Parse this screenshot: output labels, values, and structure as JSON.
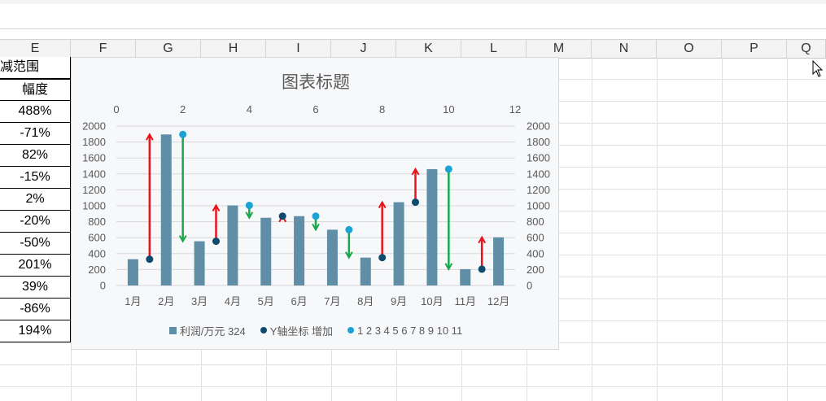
{
  "columns": [
    "E",
    "F",
    "G",
    "H",
    "I",
    "J",
    "K",
    "L",
    "M",
    "N",
    "O",
    "P",
    "Q"
  ],
  "table": {
    "header_partial": "减范围",
    "col_header": "幅度",
    "values": [
      "488%",
      "-71%",
      "82%",
      "-15%",
      "2%",
      "-20%",
      "-50%",
      "201%",
      "39%",
      "-86%",
      "194%"
    ]
  },
  "chart": {
    "title": "图表标题",
    "legend": {
      "bars": "利润/万元 324",
      "dark_points": "Y轴坐标 增加",
      "light_points": "1 2 3 4 5 6 7 8 9 10 11"
    },
    "colors": {
      "bar": "#5f8ea6",
      "dark_point": "#0e4a6e",
      "light_point": "#1aa3d4",
      "up_arrow": "#e8141c",
      "down_arrow": "#18a84a",
      "gridline": "#d9d9d9"
    }
  },
  "chart_data": {
    "type": "bar",
    "title": "图表标题",
    "categories": [
      "1月",
      "2月",
      "3月",
      "4月",
      "5月",
      "6月",
      "7月",
      "8月",
      "9月",
      "10月",
      "11月",
      "12月"
    ],
    "series": [
      {
        "name": "利润/万元 324",
        "type": "bar",
        "values": [
          330,
          1895,
          555,
          1005,
          850,
          870,
          700,
          350,
          1045,
          1460,
          205,
          605
        ]
      },
      {
        "name": "Y轴坐标 增加",
        "type": "scatter",
        "x": [
          1,
          3,
          5,
          9,
          11,
          8
        ],
        "y": [
          330,
          555,
          870,
          1045,
          205,
          350
        ]
      },
      {
        "name": "1 2 3 4 5 6 7 8 9 10 11",
        "type": "scatter",
        "x": [
          2,
          4,
          6,
          7,
          10
        ],
        "y": [
          1895,
          1005,
          870,
          700,
          1460
        ]
      }
    ],
    "arrows": [
      {
        "x": 1,
        "from": 330,
        "to": 1895,
        "direction": "up"
      },
      {
        "x": 2,
        "from": 1895,
        "to": 555,
        "direction": "down"
      },
      {
        "x": 3,
        "from": 555,
        "to": 1005,
        "direction": "up"
      },
      {
        "x": 4,
        "from": 1005,
        "to": 850,
        "direction": "down"
      },
      {
        "x": 5,
        "from": 850,
        "to": 870,
        "direction": "up"
      },
      {
        "x": 6,
        "from": 870,
        "to": 700,
        "direction": "down"
      },
      {
        "x": 7,
        "from": 700,
        "to": 350,
        "direction": "down"
      },
      {
        "x": 8,
        "from": 350,
        "to": 1045,
        "direction": "up"
      },
      {
        "x": 9,
        "from": 1045,
        "to": 1460,
        "direction": "up"
      },
      {
        "x": 10,
        "from": 1460,
        "to": 205,
        "direction": "down"
      },
      {
        "x": 11,
        "from": 205,
        "to": 605,
        "direction": "up"
      }
    ],
    "y_left": {
      "min": 0,
      "max": 2000,
      "ticks": [
        "0",
        "200",
        "400",
        "600",
        "800",
        "1000",
        "1200",
        "1400",
        "1600",
        "1800",
        "2000"
      ]
    },
    "y_right": {
      "min": 0,
      "max": 2000,
      "ticks": [
        "0",
        "200",
        "400",
        "600",
        "800",
        "1000",
        "1200",
        "1400",
        "1600",
        "1800",
        "2000"
      ]
    },
    "x_top": {
      "min": 0,
      "max": 12,
      "ticks": [
        "0",
        "2",
        "4",
        "6",
        "8",
        "10",
        "12"
      ]
    },
    "grid": true,
    "legend_position": "bottom"
  }
}
